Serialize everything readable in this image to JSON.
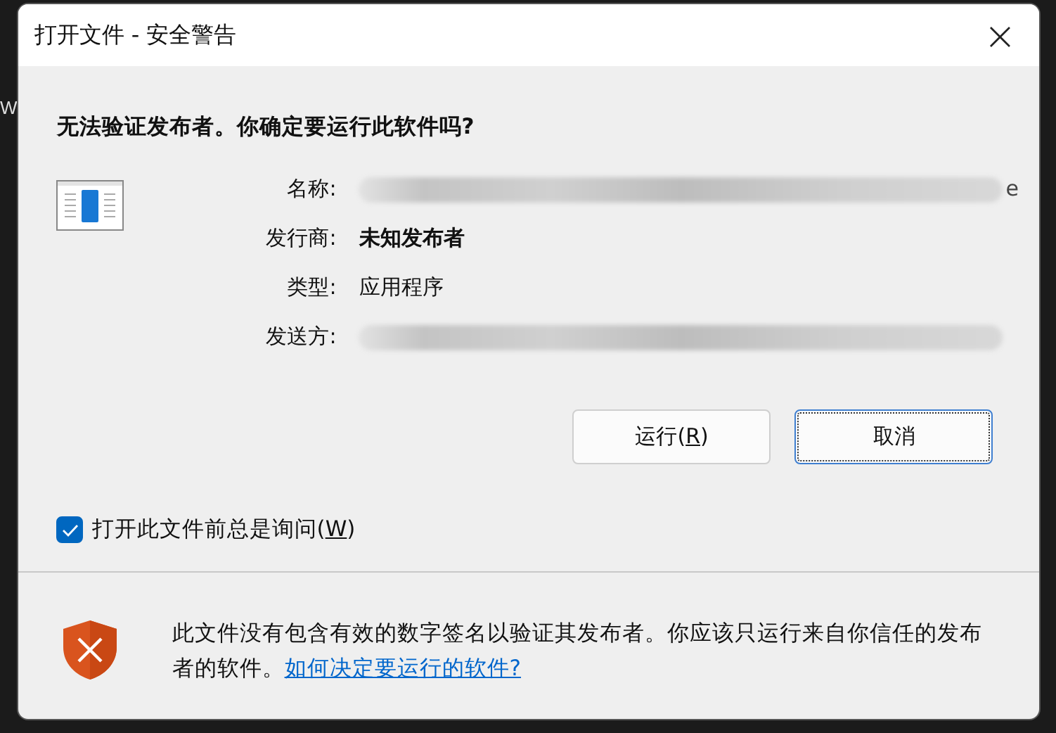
{
  "background": {
    "text": "W"
  },
  "window": {
    "title": "打开文件 - 安全警告",
    "close": "×"
  },
  "heading": "无法验证发布者。你确定要运行此软件吗?",
  "fields": [
    {
      "label": "名称:",
      "kind": "redacted",
      "value": "e"
    },
    {
      "label": "发行商:",
      "kind": "bold",
      "value": "未知发布者"
    },
    {
      "label": "类型:",
      "kind": "plain",
      "value": "应用程序"
    },
    {
      "label": "发送方:",
      "kind": "redacted"
    }
  ],
  "buttons": [
    {
      "before": "运行(",
      "access_key": "R",
      "after": ")",
      "focused": false
    },
    {
      "before": "取消",
      "focused": true
    }
  ],
  "checkbox": {
    "before": "打开此文件前总是询问(",
    "access_key": "W",
    "after": ")",
    "checked": true
  },
  "footer": {
    "text": "此文件没有包含有效的数字签名以验证其发布者。你应该只运行来自你信任的发布者的软件。",
    "link": "如何决定要运行的软件?"
  }
}
